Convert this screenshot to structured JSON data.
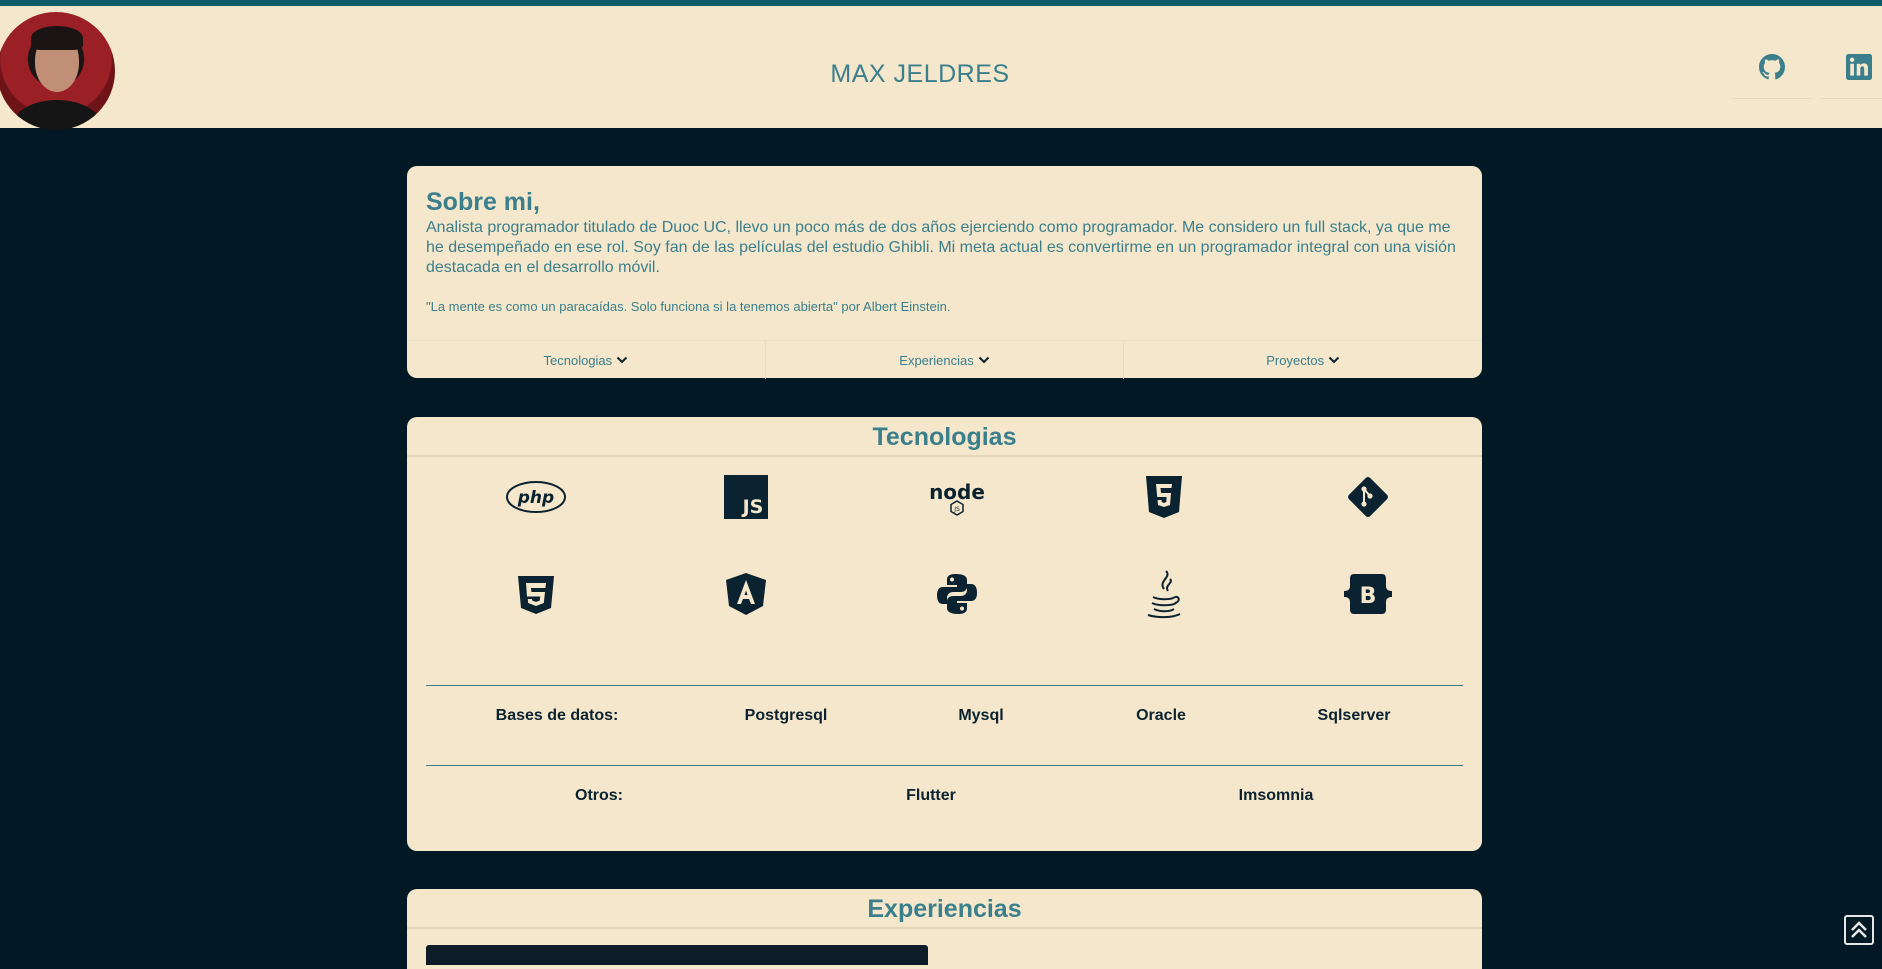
{
  "header": {
    "site_title": "MAX JELDRES",
    "social": [
      {
        "icon": "github-icon"
      },
      {
        "icon": "linkedin-icon"
      }
    ]
  },
  "about": {
    "title": "Sobre mi,",
    "body": "Analista programador titulado de Duoc UC, llevo un poco más de dos años ejerciendo como programador. Me considero un full stack, ya que me he desempeñado en ese rol. Soy fan de las películas del estudio Ghibli. Mi meta actual es convertirme en un programador integral con una visión destacada en el desarrollo móvil.",
    "quote": "\"La mente es como un paracaídas. Solo funciona si la tenemos abierta\" por Albert Einstein.",
    "tabs": [
      {
        "label": "Tecnologias"
      },
      {
        "label": "Experiencias"
      },
      {
        "label": "Proyectos"
      }
    ]
  },
  "technologies": {
    "title": "Tecnologias",
    "icons": [
      "php-icon",
      "javascript-icon",
      "nodejs-icon",
      "html5-icon",
      "git-icon",
      "css3-icon",
      "angular-icon",
      "python-icon",
      "java-icon",
      "bootstrap-icon"
    ],
    "databases_label": "Bases de datos:",
    "databases": [
      "Postgresql",
      "Mysql",
      "Oracle",
      "Sqlserver"
    ],
    "others_label": "Otros:",
    "others": [
      "Flutter",
      "Imsomnia"
    ]
  },
  "experiences": {
    "title": "Experiencias"
  },
  "colors": {
    "background": "#021825",
    "card": "#f4e7cb",
    "accent": "#3b7f8c",
    "top_border": "#0e5c6b"
  }
}
